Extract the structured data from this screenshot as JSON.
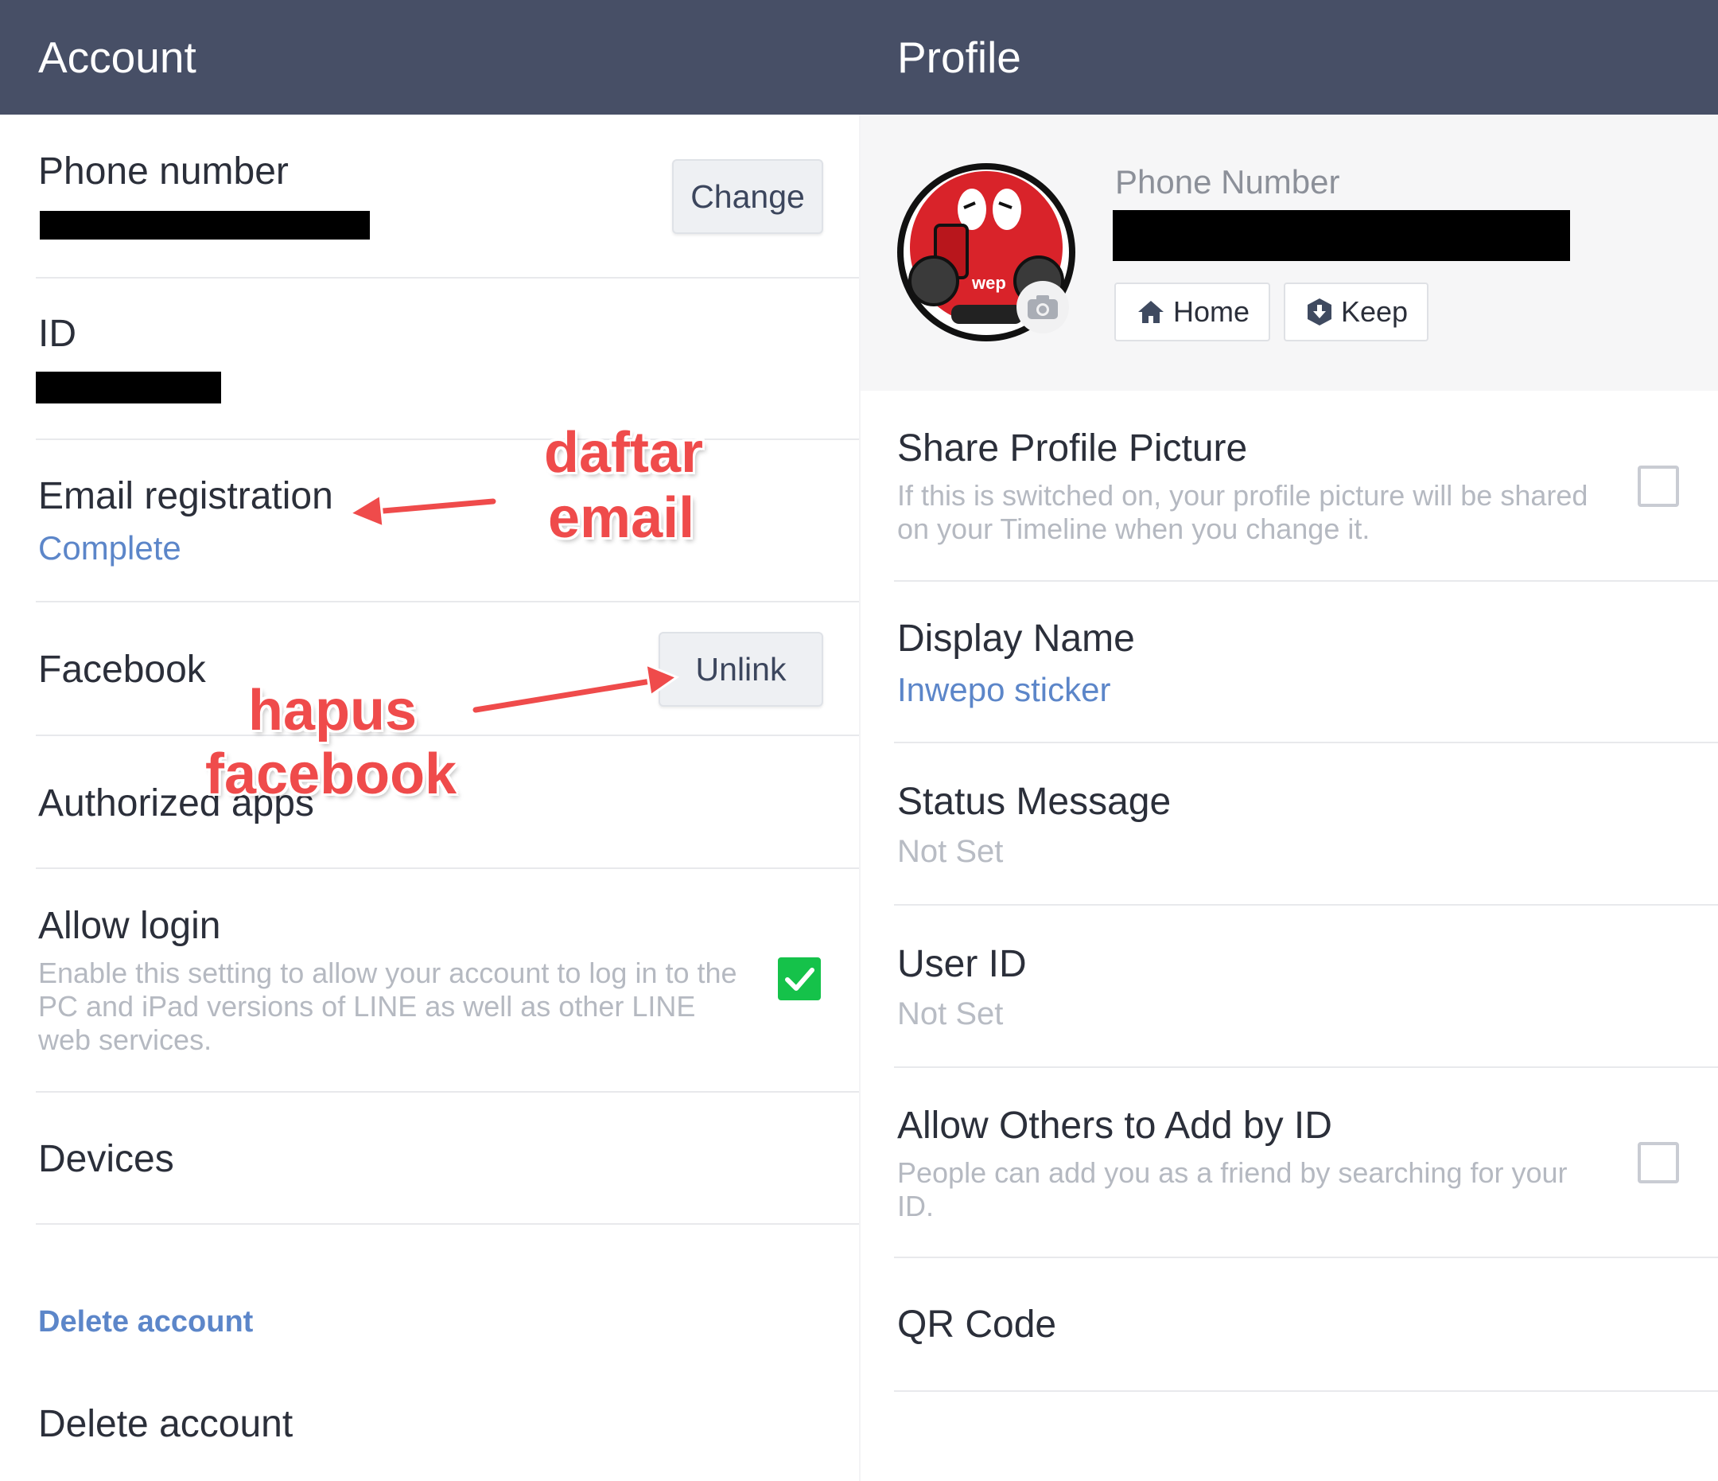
{
  "account": {
    "header": "Account",
    "phone_label": "Phone number",
    "change_button": "Change",
    "id_label": "ID",
    "email_label": "Email registration",
    "email_status": "Complete",
    "facebook_label": "Facebook",
    "unlink_button": "Unlink",
    "authorized_apps_label": "Authorized apps",
    "allow_login_label": "Allow login",
    "allow_login_desc": "Enable this setting to allow your account to log in to the PC and iPad versions of LINE as well as other LINE web services.",
    "allow_login_checked": true,
    "devices_label": "Devices",
    "delete_section_header": "Delete account",
    "delete_account_label": "Delete account"
  },
  "profile": {
    "header": "Profile",
    "phone_number_label": "Phone Number",
    "home_button": "Home",
    "keep_button": "Keep",
    "avatar_text": "wep",
    "share_picture_label": "Share Profile Picture",
    "share_picture_desc": "If this is switched on, your profile picture will be shared on your Timeline when you change it.",
    "share_picture_checked": false,
    "display_name_label": "Display Name",
    "display_name_value": "Inwepo sticker",
    "status_message_label": "Status Message",
    "status_message_value": "Not Set",
    "user_id_label": "User ID",
    "user_id_value": "Not Set",
    "allow_add_label": "Allow Others to Add by ID",
    "allow_add_desc": "People can add you as a friend by searching for your ID.",
    "allow_add_checked": false,
    "qr_code_label": "QR Code"
  },
  "annotations": {
    "email_line1": "daftar",
    "email_line2": "email",
    "facebook_line1": "hapus",
    "facebook_line2": "facebook"
  },
  "colors": {
    "header_bg": "#474f66",
    "link_blue": "#5c86c9",
    "check_green": "#15c24a",
    "annotation_red": "#ef4b4b"
  },
  "icons": {
    "home": "home-icon",
    "keep": "keep-icon",
    "camera": "camera-icon",
    "check": "check-icon",
    "arrow": "arrow-icon"
  }
}
